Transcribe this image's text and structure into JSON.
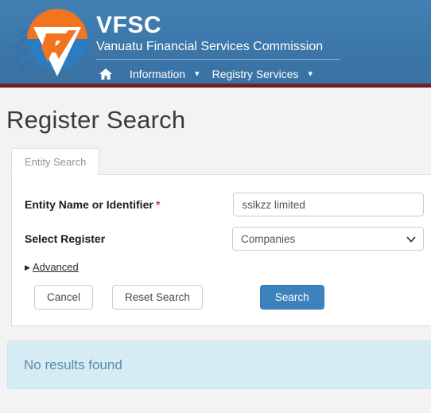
{
  "header": {
    "logo_icon": "vfsc-shield-logo",
    "brand_title": "VFSC",
    "brand_subtitle": "Vanuatu Financial Services Commission",
    "nav": {
      "home_icon": "home-icon",
      "items": [
        {
          "label": "Information",
          "caret_icon": "chevron-down-icon"
        },
        {
          "label": "Registry Services",
          "caret_icon": "chevron-down-icon"
        }
      ]
    },
    "colors": {
      "header_blue": "#3b76a8",
      "stripe_maroon": "#6e1d21",
      "logo_orange": "#f2741f",
      "logo_blue": "#2b7cc0"
    }
  },
  "page": {
    "title": "Register Search",
    "tabs": [
      {
        "label": "Entity Search",
        "active": true
      }
    ],
    "form": {
      "entity_label": "Entity Name or Identifier",
      "entity_required_mark": "*",
      "entity_value": "sslkzz limited",
      "entity_placeholder": "",
      "register_label": "Select Register",
      "register_value": "Companies",
      "register_caret_icon": "chevron-down-icon",
      "advanced_toggle_icon": "triangle-right-icon",
      "advanced_label": "Advanced",
      "buttons": {
        "cancel": "Cancel",
        "reset": "Reset Search",
        "search": "Search"
      },
      "colors": {
        "search_button": "#3d81bd",
        "required_star": "#d9364a"
      }
    },
    "results": {
      "message": "No results found",
      "colors": {
        "background": "#d6ecf5",
        "text": "#5b8ba3"
      }
    }
  }
}
